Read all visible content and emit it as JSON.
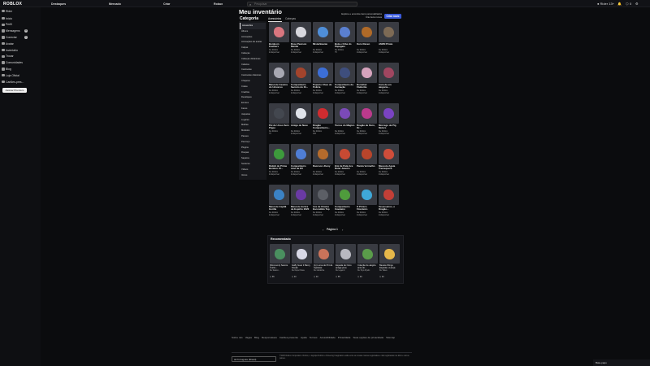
{
  "topbar": {
    "logo": "ROBLOX",
    "nav": [
      "Destaques",
      "Mercado",
      "Criar",
      "Robux"
    ],
    "search_placeholder": "Pesquisar",
    "username": "Rider",
    "age_label": "13+",
    "robux": "0"
  },
  "leftnav": {
    "username": "Rider",
    "items": [
      {
        "label": "Início",
        "icon": "home-icon"
      },
      {
        "label": "Perfil",
        "icon": "profile-icon"
      },
      {
        "label": "Mensagens",
        "icon": "messages-icon",
        "badge": "9"
      },
      {
        "label": "Conectar",
        "icon": "friends-icon",
        "badge": "1"
      },
      {
        "label": "Avatar",
        "icon": "avatar-icon"
      },
      {
        "label": "Inventário",
        "icon": "inventory-icon"
      },
      {
        "label": "Trocar",
        "icon": "trade-icon"
      },
      {
        "label": "Comunidades",
        "icon": "groups-icon"
      },
      {
        "label": "Blog",
        "icon": "blog-icon"
      },
      {
        "label": "Loja Oficial",
        "icon": "store-icon"
      },
      {
        "label": "Cartões-pres...",
        "icon": "giftcard-icon"
      }
    ],
    "premium_button": "Assinar Premium"
  },
  "main": {
    "title": "Meu inventário",
    "category_heading": "Categoria",
    "tabs": [
      "Acessórios",
      "Cabeças"
    ],
    "promo_text": [
      "Explore e encontre itens personalizados",
      "Crie itens novos"
    ],
    "create_button": "Criar novo"
  },
  "categories": [
    "Acessórios",
    "Álbuns",
    "Animações",
    "Animações de avatar",
    "Calças",
    "Cabeças",
    "Cabeças dinâmicas",
    "Cabelos",
    "Camisetas",
    "Camisetas clássicas",
    "Chapéus",
    "Colete",
    "Crachás",
    "Decalques",
    "Emotes",
    "Faces",
    "Jaquetas",
    "Lugares",
    "Malhas",
    "Modelos",
    "Passes",
    "Pescoço",
    "Plugins",
    "Roupas",
    "Sapatos",
    "Suéteres",
    "Vídeos",
    "Vozes"
  ],
  "items": [
    {
      "name": "Bombom Feathers",
      "by": "De Roblox",
      "sub": "Indisponível",
      "color": "#d9767f"
    },
    {
      "name": "Rose Pearson Mantle",
      "by": "De Roblox",
      "sub": "Indisponível",
      "color": "#d7d7dd"
    },
    {
      "name": "MisterBeanie",
      "by": "De Roblox",
      "sub": "Indisponível",
      "color": "#4f8ed8"
    },
    {
      "name": "Bola e Orbe do Papagaio",
      "by": "De Roblox",
      "sub": "75",
      "color": "#5a7fd0"
    },
    {
      "name": "Kuro Raven",
      "by": "De Roblox",
      "sub": "Indisponível",
      "color": "#b06a28"
    },
    {
      "name": "AMZN Pirate",
      "by": "De Roblox",
      "sub": "Indisponível",
      "color": "#7d6a55"
    },
    {
      "name": "Mascote Caveira do Universo",
      "by": "De Roblox",
      "sub": "Indisponível",
      "color": "#a8a8b2"
    },
    {
      "name": "Companheiro Secreto do Dr...",
      "by": "De Roblox",
      "sub": "Indisponível",
      "color": "#a3442c"
    },
    {
      "name": "Pupurio Chuo do Polícia",
      "by": "De Roblox",
      "sub": "Indisponível",
      "color": "#3c6ed6"
    },
    {
      "name": "Companheiro da Carnação",
      "by": "De Roblox",
      "sub": "Indisponível",
      "color": "#3e4e7d"
    },
    {
      "name": "Bonnibel Fluttertie",
      "by": "De Roblox",
      "sub": "Indisponível",
      "color": "#d6a3bd"
    },
    {
      "name": "Cara de um alegoria...",
      "by": "De Roblox",
      "sub": "Indisponível",
      "color": "#a04660"
    },
    {
      "name": "Pet de Ursso Sem Pippo",
      "by": "De Roblox",
      "sub": "75",
      "color": "#43474f"
    },
    {
      "name": "Amigo de Neve",
      "by": "De Roblox",
      "sub": "Indisponível",
      "color": "#e0e3ea"
    },
    {
      "name": "Dragão Companheiro...",
      "by": "De Roblox",
      "sub": "100",
      "color": "#cf2c30"
    },
    {
      "name": "Tomos do Mágico",
      "by": "De Roblox",
      "sub": "Indisponível",
      "color": "#7b4ab8"
    },
    {
      "name": "Dragão de Ouro, Or...",
      "by": "De Roblox",
      "sub": "Indisponível",
      "color": "#bb3a8c"
    },
    {
      "name": "Morcego de Pig Meters",
      "by": "De Roblox",
      "sub": "Indisponível",
      "color": "#7a43c2"
    },
    {
      "name": "Rattoli de Prima Bonbon 10...",
      "by": "De Roblox",
      "sub": "Indisponível",
      "color": "#3d9a3c"
    },
    {
      "name": "Companheiro Azul de EU",
      "by": "De Roblox",
      "sub": "Indisponível",
      "color": "#4f7ed6"
    },
    {
      "name": "Raccoon Jhony",
      "by": "De Roblox",
      "sub": "Indisponível",
      "color": "#b46b2c"
    },
    {
      "name": "Emi de Pata Ace Ruter Janeiro",
      "by": "De Roblox",
      "sub": "Indisponível",
      "color": "#c84a33"
    },
    {
      "name": "Panda Vermelho",
      "by": "De Roblox",
      "sub": "Indisponível",
      "color": "#b8452b"
    },
    {
      "name": "Mascote Aguia Tremequera",
      "by": "De Roblox",
      "sub": "Indisponível",
      "color": "#cf4d3a"
    },
    {
      "name": "Mascote Capitã Gorilla",
      "by": "De Roblox",
      "sub": "Indisponível",
      "color": "#3b82c4"
    },
    {
      "name": "Mascote da Era de Espírito 2020",
      "by": "De Roblox",
      "sub": "Indisponível",
      "color": "#6a3aa4"
    },
    {
      "name": "Ave de Chama Escondido Top",
      "by": "De Roblox",
      "sub": "Indisponível",
      "color": "#5c5f66"
    },
    {
      "name": "Companheiro Cavaleiro",
      "by": "De Roblox",
      "sub": "Indisponível",
      "color": "#4f9c3c"
    },
    {
      "name": "O Pônico Floreteiro",
      "by": "De Roblox",
      "sub": "Indisponível",
      "color": "#3fa8d8"
    },
    {
      "name": "Teseuseiros, o Dragão...",
      "by": "De Roblox",
      "sub": "Indisponível",
      "color": "#c23f37"
    }
  ],
  "pager": {
    "label": "Página 1",
    "prev": "‹",
    "next": "›"
  },
  "recommended": {
    "title": "Recomendado",
    "items": [
      {
        "name": "[Rommom] Sannie Curtis...",
        "by": "De Saison...",
        "price": "65",
        "color": "#4a8f5f"
      },
      {
        "name": "Gaffy Gear it Barcy Sneak",
        "by": "De Duper Dane",
        "price": "40",
        "color": "#d8d8e6"
      },
      {
        "name": "(A) Lorna de Pi4 de Injetatae",
        "by": "De Goldwrite",
        "price": "40",
        "color": "#c9735a"
      },
      {
        "name": "Espada de Ouro antiga pura",
        "by": "De Legend",
        "price": "65",
        "color": "#b8b8c0"
      },
      {
        "name": "Coleção de alegria ante do...",
        "by": "De Styx-Mystic",
        "price": "40",
        "color": "#5a9c4a"
      },
      {
        "name": "Banata Wings Espada e Lança",
        "by": "De Takes",
        "price": "40",
        "color": "#e6b84a"
      }
    ]
  },
  "footer": {
    "links": [
      "Sobre nós",
      "Vagas",
      "Blog",
      "Responsáveis",
      "Cartões-presente",
      "Ajuda",
      "Termos",
      "Acessibilidade",
      "Privacidade",
      "Suas opções de privacidade",
      "Sitemap"
    ],
    "language": "Português (Brasil)",
    "copyright": "©2025 Roblox Corporation. Roblox, o logotipo Roblox e Powering Imagination estão entre as nossas marcas registradas e não registradas nos EUA e outros países.",
    "chat": "Bate-papo"
  }
}
